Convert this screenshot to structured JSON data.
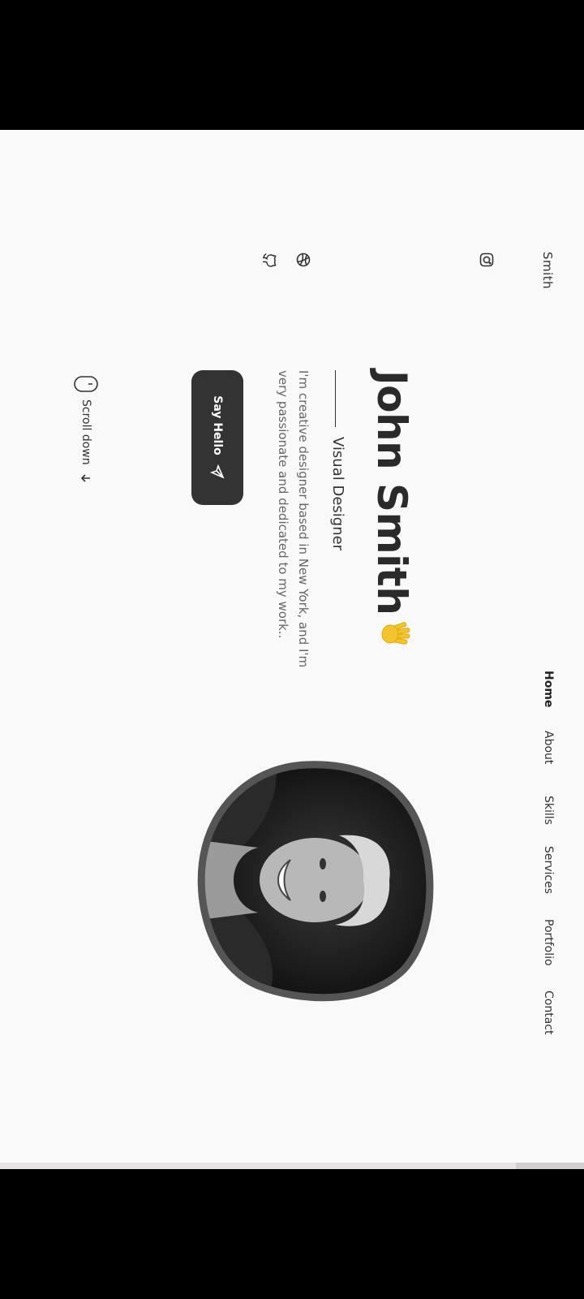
{
  "nav": {
    "logo": "Smith",
    "items": [
      "Home",
      "About",
      "Skills",
      "Services",
      "Portfolio",
      "Contact"
    ]
  },
  "social": [
    "instagram-icon",
    "dribbble-icon",
    "github-icon"
  ],
  "hero": {
    "name": "John Smith",
    "title": "Visual Designer",
    "description": "I'm creative designer based in New York, and I'm very passionate and dedicated to my work..",
    "button": "Say Hello",
    "scroll": "Scroll down"
  },
  "colors": {
    "background": "#f9f9f9",
    "button": "#333333",
    "accent": "#f4c430"
  }
}
